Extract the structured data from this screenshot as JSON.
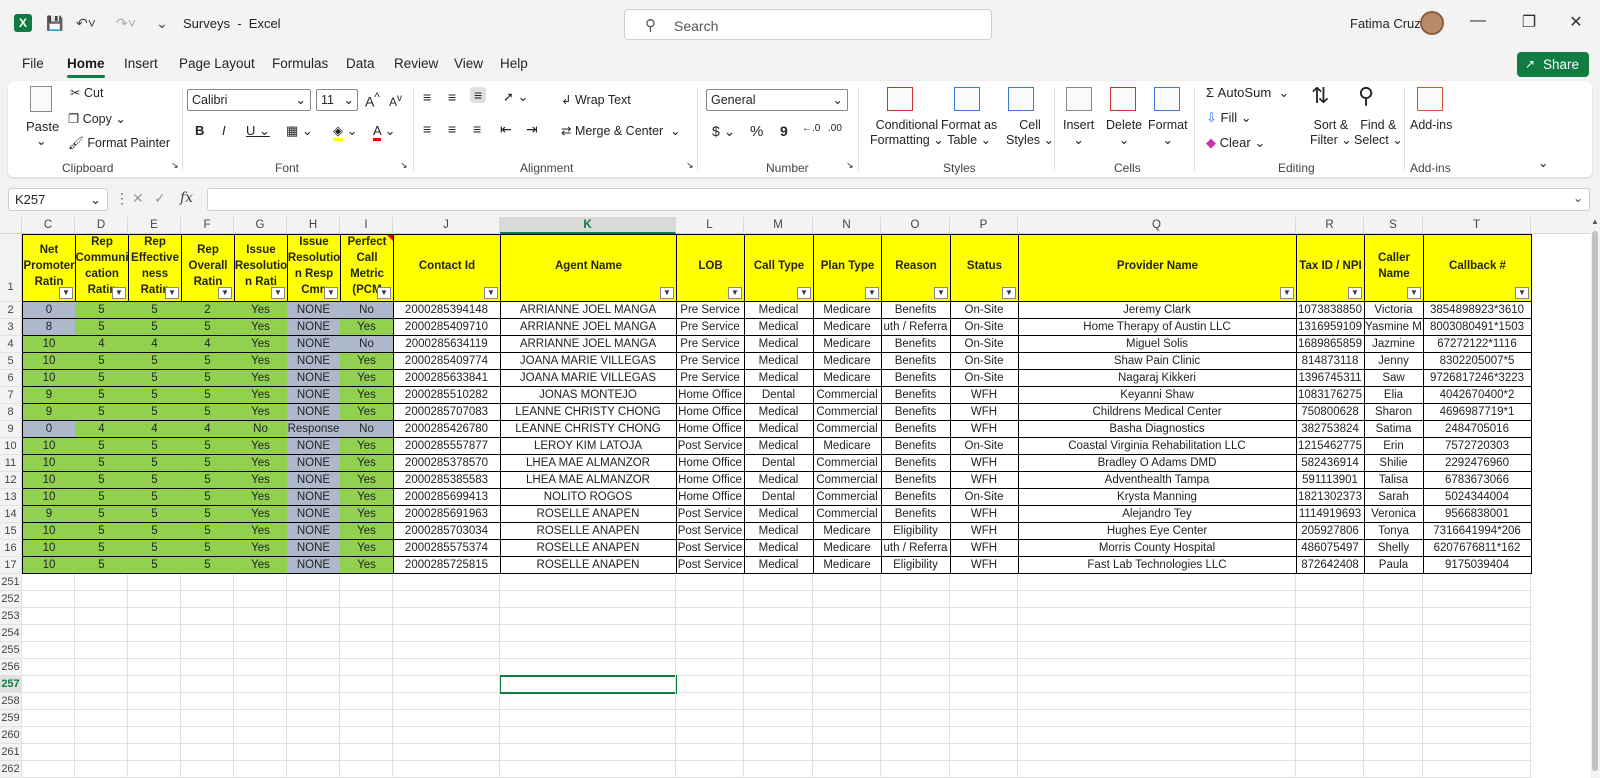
{
  "app": {
    "doc_title": "Surveys",
    "separator": "-",
    "app_name": "Excel",
    "search_placeholder": "Search",
    "user_name": "Fatima Cruz"
  },
  "menu": [
    "File",
    "Home",
    "Insert",
    "Page Layout",
    "Formulas",
    "Data",
    "Review",
    "View",
    "Help"
  ],
  "share_label": "Share",
  "ribbon": {
    "clipboard": {
      "paste": "Paste",
      "cut": "Cut",
      "copy": "Copy",
      "format_painter": "Format Painter",
      "label": "Clipboard"
    },
    "font": {
      "name": "Calibri",
      "size": "11",
      "bold": "B",
      "italic": "I",
      "underline": "U",
      "label": "Font"
    },
    "alignment": {
      "wrap": "Wrap Text",
      "merge": "Merge & Center",
      "label": "Alignment"
    },
    "number": {
      "format": "General",
      "currency": "$",
      "percent": "%",
      "comma": "9",
      "label": "Number"
    },
    "styles": {
      "cond": "Conditional",
      "cond2": "Formatting",
      "table": "Format as",
      "table2": "Table",
      "cell": "Cell",
      "cell2": "Styles",
      "label": "Styles"
    },
    "cells": {
      "insert": "Insert",
      "delete": "Delete",
      "format": "Format",
      "label": "Cells"
    },
    "editing": {
      "autosum": "AutoSum",
      "fill": "Fill",
      "clear": "Clear",
      "sort": "Sort &",
      "sort2": "Filter",
      "find": "Find &",
      "find2": "Select",
      "label": "Editing"
    },
    "addins": {
      "btn": "Add-ins",
      "label": "Add-ins"
    }
  },
  "name_box": "K257",
  "formula_value": "",
  "columns": [
    "C",
    "D",
    "E",
    "F",
    "G",
    "H",
    "I",
    "J",
    "K",
    "L",
    "M",
    "N",
    "O",
    "P",
    "Q",
    "R",
    "S",
    "T"
  ],
  "headers": [
    "Net Promoter Ratin",
    "Rep Communi cation Ratin",
    "Rep Effective ness Ratin",
    "Rep Overall Ratin",
    "Issue Resolutio n Rati",
    "Issue Resolutio n Resp Cmn",
    "Perfect Call Metric (PCM",
    "Contact Id",
    "Agent Name",
    "LOB",
    "Call Type",
    "Plan Type",
    "Reason",
    "Status",
    "Provider Name",
    "Tax ID / NPI",
    "Caller Name",
    "Callback #"
  ],
  "row_numbers": [
    "2",
    "3",
    "4",
    "5",
    "6",
    "7",
    "8",
    "9",
    "10",
    "11",
    "12",
    "13",
    "14",
    "15",
    "16",
    "17"
  ],
  "rows": [
    [
      "0",
      "5",
      "5",
      "2",
      "Yes",
      "NONE",
      "No",
      "2000285394148",
      "ARRIANNE JOEL MANGA",
      "Pre Service",
      "Medical",
      "Medicare",
      "Benefits",
      "On-Site",
      "Jeremy Clark",
      "1073838850",
      "Victoria",
      "3854898923*3610"
    ],
    [
      "8",
      "5",
      "5",
      "5",
      "Yes",
      "NONE",
      "Yes",
      "2000285409710",
      "ARRIANNE JOEL MANGA",
      "Pre Service",
      "Medical",
      "Medicare",
      "uth / Referra",
      "On-Site",
      "Home Therapy of Austin LLC",
      "1316959109",
      "Yasmine M",
      "8003080491*1503"
    ],
    [
      "10",
      "4",
      "4",
      "4",
      "Yes",
      "NONE",
      "No",
      "2000285634119",
      "ARRIANNE JOEL MANGA",
      "Pre Service",
      "Medical",
      "Medicare",
      "Benefits",
      "On-Site",
      "Miguel Solis",
      "1689865859",
      "Jazmine",
      "67272122*1116"
    ],
    [
      "10",
      "5",
      "5",
      "5",
      "Yes",
      "NONE",
      "Yes",
      "2000285409774",
      "JOANA MARIE VILLEGAS",
      "Pre Service",
      "Medical",
      "Medicare",
      "Benefits",
      "On-Site",
      "Shaw Pain Clinic",
      "814873118",
      "Jenny",
      "8302205007*5"
    ],
    [
      "10",
      "5",
      "5",
      "5",
      "Yes",
      "NONE",
      "Yes",
      "2000285633841",
      "JOANA MARIE VILLEGAS",
      "Pre Service",
      "Medical",
      "Medicare",
      "Benefits",
      "On-Site",
      "Nagaraj Kikkeri",
      "1396745311",
      "Saw",
      "9726817246*3223"
    ],
    [
      "9",
      "5",
      "5",
      "5",
      "Yes",
      "NONE",
      "Yes",
      "2000285510282",
      "JONAS MONTEJO",
      "Home Office",
      "Dental",
      "Commercial",
      "Benefits",
      "WFH",
      "Keyanni Shaw",
      "1083176275",
      "Elia",
      "4042670400*2"
    ],
    [
      "9",
      "5",
      "5",
      "5",
      "Yes",
      "NONE",
      "Yes",
      "2000285707083",
      "LEANNE CHRISTY CHONG",
      "Home Office",
      "Medical",
      "Commercial",
      "Benefits",
      "WFH",
      "Childrens Medical Center",
      "750800628",
      "Sharon",
      "4696987719*1"
    ],
    [
      "0",
      "4",
      "4",
      "4",
      "No",
      "Response",
      "No",
      "2000285426780",
      "LEANNE CHRISTY CHONG",
      "Home Office",
      "Medical",
      "Commercial",
      "Benefits",
      "WFH",
      "Basha Diagnostics",
      "382753824",
      "Satima",
      "2484705016"
    ],
    [
      "10",
      "5",
      "5",
      "5",
      "Yes",
      "NONE",
      "Yes",
      "2000285557877",
      "LEROY KIM LATOJA",
      "Post Service",
      "Medical",
      "Medicare",
      "Benefits",
      "On-Site",
      "Coastal Virginia Rehabilitation LLC",
      "1215462775",
      "Erin",
      "7572720303"
    ],
    [
      "10",
      "5",
      "5",
      "5",
      "Yes",
      "NONE",
      "Yes",
      "2000285378570",
      "LHEA MAE ALMANZOR",
      "Home Office",
      "Dental",
      "Commercial",
      "Benefits",
      "WFH",
      "Bradley O Adams DMD",
      "582436914",
      "Shilie",
      "2292476960"
    ],
    [
      "10",
      "5",
      "5",
      "5",
      "Yes",
      "NONE",
      "Yes",
      "2000285385583",
      "LHEA MAE ALMANZOR",
      "Home Office",
      "Medical",
      "Commercial",
      "Benefits",
      "WFH",
      "Adventhealth Tampa",
      "591113901",
      "Talisa",
      "6783673066"
    ],
    [
      "10",
      "5",
      "5",
      "5",
      "Yes",
      "NONE",
      "Yes",
      "2000285699413",
      "NOLITO ROGOS",
      "Home Office",
      "Dental",
      "Commercial",
      "Benefits",
      "On-Site",
      "Krysta Manning",
      "1821302373",
      "Sarah",
      "5024344004"
    ],
    [
      "9",
      "5",
      "5",
      "5",
      "Yes",
      "NONE",
      "Yes",
      "2000285691963",
      "ROSELLE ANAPEN",
      "Post Service",
      "Medical",
      "Commercial",
      "Benefits",
      "WFH",
      "Alejandro Tey",
      "1114919693",
      "Veronica",
      "9566838001"
    ],
    [
      "10",
      "5",
      "5",
      "5",
      "Yes",
      "NONE",
      "Yes",
      "2000285703034",
      "ROSELLE ANAPEN",
      "Post Service",
      "Medical",
      "Medicare",
      "Eligibility",
      "WFH",
      "Hughes Eye Center",
      "205927806",
      "Tonya",
      "7316641994*206"
    ],
    [
      "10",
      "5",
      "5",
      "5",
      "Yes",
      "NONE",
      "Yes",
      "2000285575374",
      "ROSELLE ANAPEN",
      "Post Service",
      "Medical",
      "Medicare",
      "uth / Referra",
      "WFH",
      "Morris County Hospital",
      "486075497",
      "Shelly",
      "6207676811*162"
    ],
    [
      "10",
      "5",
      "5",
      "5",
      "Yes",
      "NONE",
      "Yes",
      "2000285725815",
      "ROSELLE ANAPEN",
      "Post Service",
      "Medical",
      "Medicare",
      "Eligibility",
      "WFH",
      "Fast Lab Technologies LLC",
      "872642408",
      "Paula",
      "9175039404"
    ]
  ],
  "empty_rows": [
    "251",
    "252",
    "253",
    "254",
    "255",
    "256",
    "257",
    "258",
    "259",
    "260",
    "261",
    "262"
  ],
  "header_row_number": "1",
  "active_cell_row": "257",
  "colors": {
    "accent": "#107c41",
    "header_fill": "#ffff00",
    "green_fill": "#92d050",
    "blue_fill": "#adb9ca"
  }
}
